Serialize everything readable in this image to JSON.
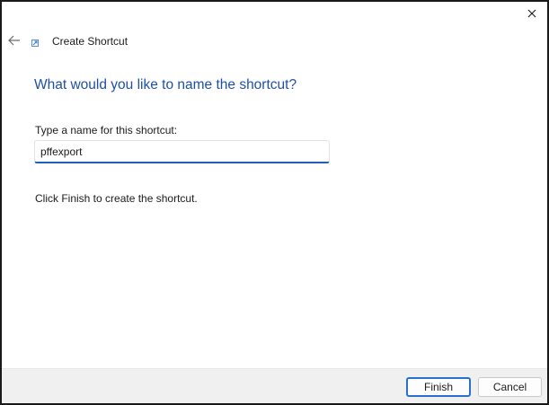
{
  "window": {
    "title": "Create Shortcut",
    "close_icon": "close-icon",
    "back_icon": "back-arrow-icon",
    "shortcut_icon": "shortcut-arrow-icon"
  },
  "main": {
    "heading": "What would you like to name the shortcut?",
    "name_label": "Type a name for this shortcut:",
    "name_value": "pffexport",
    "hint": "Click Finish to create the shortcut."
  },
  "footer": {
    "finish_label": "Finish",
    "cancel_label": "Cancel"
  },
  "colors": {
    "heading": "#1f4fa8",
    "input_underline": "#1f5fb8",
    "primary_border": "#2b6fd1",
    "footer_bg": "#f0f0f0"
  }
}
